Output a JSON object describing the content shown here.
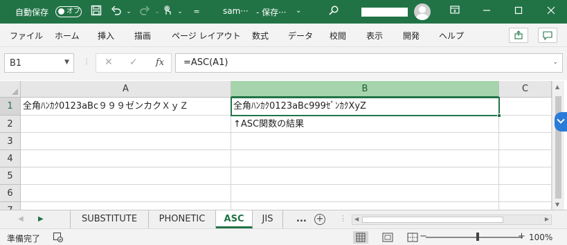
{
  "titlebar": {
    "autosave_label": "自動保存",
    "autosave_state": "オフ",
    "filename": "sam···",
    "save_status": "- 保存···",
    "dropdown_glyph": "⌄"
  },
  "ribbon": {
    "tabs": [
      "ファイル",
      "ホーム",
      "挿入",
      "描画",
      "ページ レイアウト",
      "数式",
      "データ",
      "校閲",
      "表示",
      "開発",
      "ヘルプ"
    ]
  },
  "formula": {
    "namebox": "B1",
    "cancel": "✕",
    "enter": "✓",
    "fx": "fx",
    "content": "=ASC(A1)"
  },
  "grid": {
    "columns": [
      "A",
      "B",
      "C"
    ],
    "selected_column": "B",
    "rows": [
      "1",
      "2",
      "3",
      "4",
      "5",
      "6",
      "7"
    ],
    "cells": {
      "A1": "全角ﾊﾝｶｸ0123aBc９９９ゼンカクＸｙＺ",
      "B1": "全角ﾊﾝｶｸ0123aBc999ｾﾞﾝｶｸXyZ",
      "B2": "↑ASC関数の結果"
    }
  },
  "sheets": {
    "tabs": [
      "SUBSTITUTE",
      "PHONETIC",
      "ASC",
      "JIS"
    ],
    "active": "ASC",
    "more": "...",
    "add": "+"
  },
  "status": {
    "text": "準備完了",
    "zoom_minus": "−",
    "zoom_plus": "+",
    "zoom": "100%"
  },
  "colors": {
    "accent": "#217346",
    "selected_header": "#a6d4ac"
  }
}
